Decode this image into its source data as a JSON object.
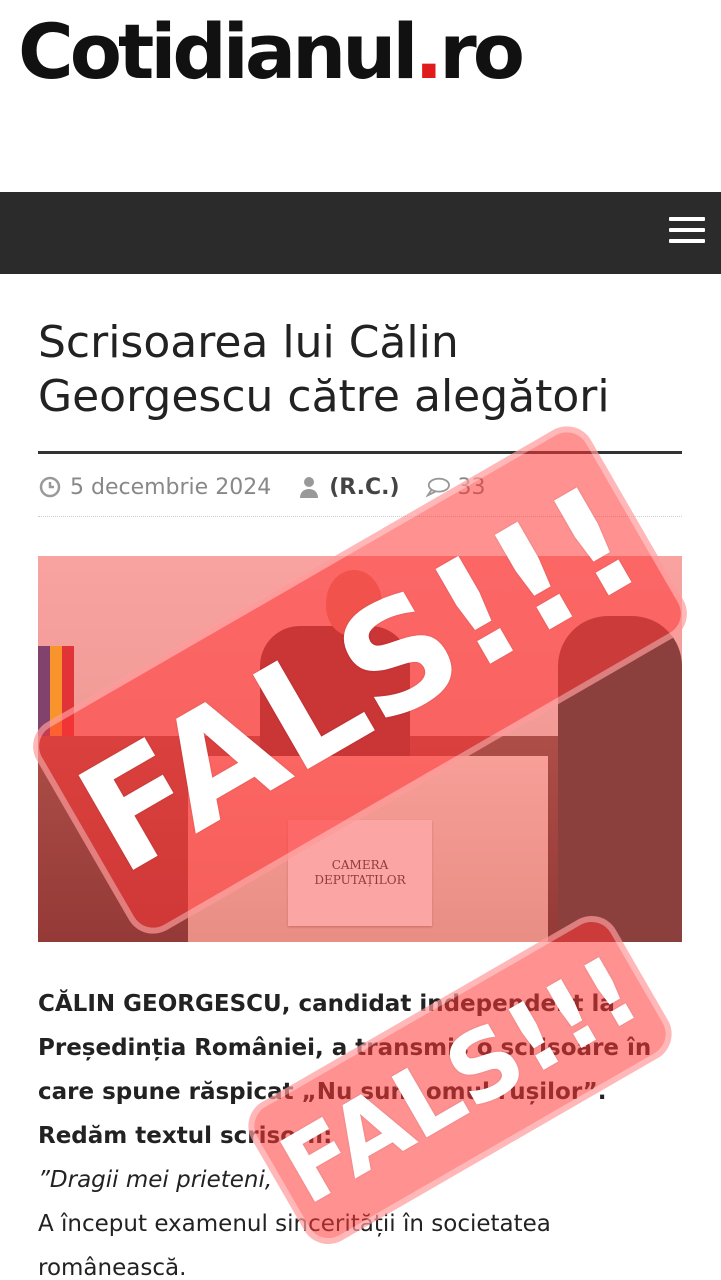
{
  "site": {
    "logo_text": "Cotidianul",
    "logo_dot": ".",
    "logo_tld": "ro"
  },
  "navbar": {
    "menu_icon": "hamburger-menu-icon"
  },
  "article": {
    "title": "Scrisoarea lui Călin Georgescu către alegători",
    "date": "5 decembrie 2024",
    "author": "(R.C.)",
    "comments_count": "33",
    "photo_sign_line1": "CAMERA",
    "photo_sign_line2": "DEPUTAȚILOR",
    "lead": "CĂLIN GEORGESCU, candidat independent la Președinția României, a transmis o scrisoare în care spune răspicat „Nu sunt omul rușilor”. Redăm textul scrisorii:",
    "quote_opening": "”Dragii mei prieteni,",
    "paragraph": "A început examenul sincerității în societatea românească."
  },
  "overlay": {
    "stamp_text": "FALS!!!",
    "stamp_color": "#ff3737"
  },
  "colors": {
    "navbar": "#2b2b2b",
    "logo_dot": "#e01b1b",
    "meta": "#888888"
  },
  "icons": {
    "date": "clock-icon",
    "author": "user-icon",
    "comments": "comment-icon"
  }
}
